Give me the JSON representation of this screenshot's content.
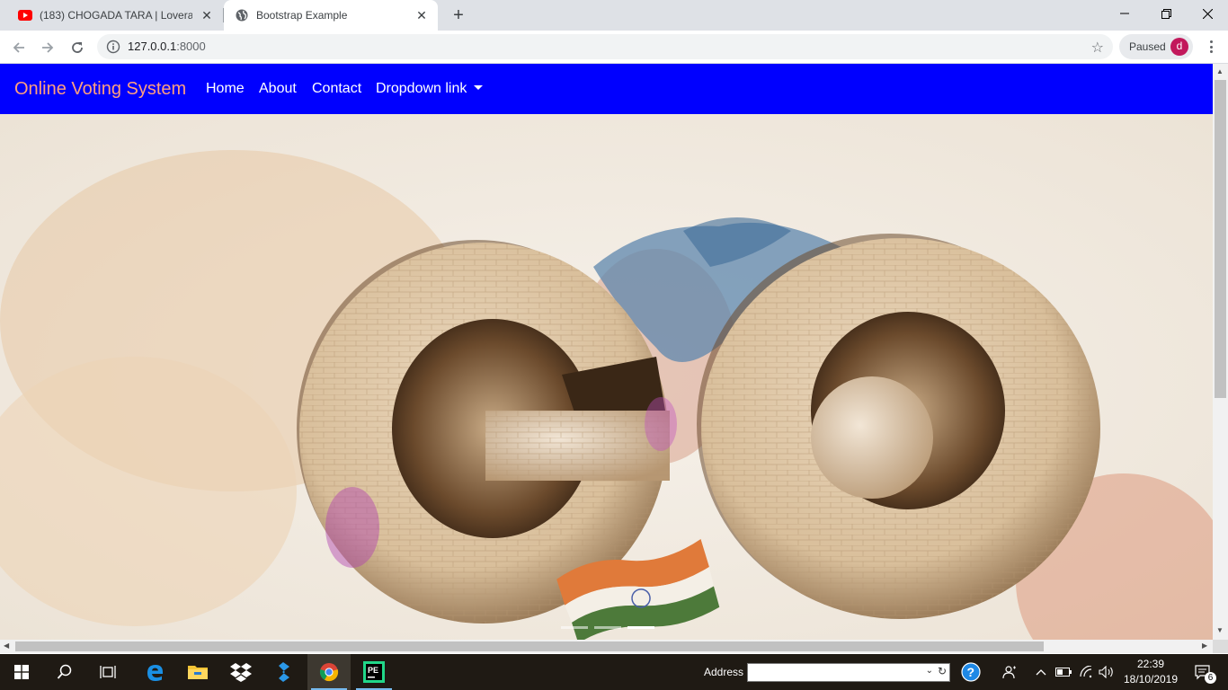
{
  "browser": {
    "tabs": [
      {
        "title": "(183) CHOGADA TARA | Loveratri",
        "favicon": "youtube-icon",
        "active": false
      },
      {
        "title": "Bootstrap Example",
        "favicon": "globe-icon",
        "active": true
      }
    ],
    "address": {
      "host": "127.0.0.1",
      "port": ":8000"
    },
    "profile": {
      "status": "Paused",
      "initial": "d"
    }
  },
  "page": {
    "navbar": {
      "brand": "Online Voting System",
      "links": [
        "Home",
        "About",
        "Contact",
        "Dropdown link"
      ],
      "background": "#0000ff",
      "brand_color": "#ff9f7f"
    },
    "carousel": {
      "image": "GO lettering artwork with Indian flag",
      "slides": 3,
      "active_slide": 3
    }
  },
  "taskbar": {
    "address_label": "Address",
    "clock_time": "22:39",
    "clock_date": "18/10/2019",
    "notifications": "6",
    "apps": [
      "start-icon",
      "search-icon",
      "task-view-icon",
      "edge-icon",
      "file-explorer-icon",
      "dropbox-icon",
      "visual-studio-icon",
      "chrome-icon",
      "pycharm-icon"
    ]
  }
}
